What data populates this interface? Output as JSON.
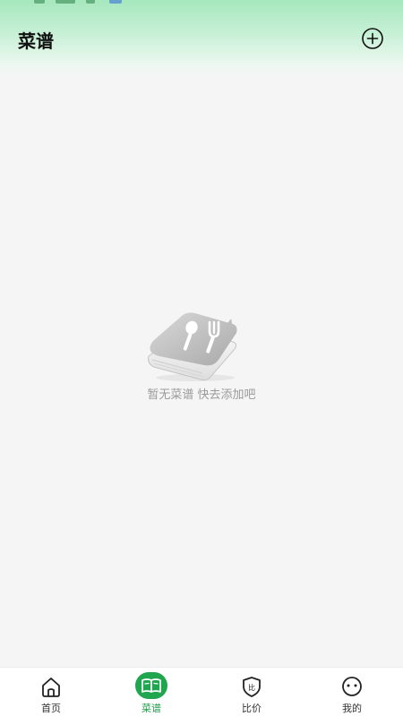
{
  "header": {
    "title": "菜谱",
    "add_icon": "plus-circle-icon"
  },
  "empty_state": {
    "illustration_icon": "recipe-book-utensils-icon",
    "message": "暂无菜谱 快去添加吧"
  },
  "tabbar": {
    "items": [
      {
        "label": "首页",
        "icon": "home-icon",
        "active": false
      },
      {
        "label": "菜谱",
        "icon": "open-book-icon",
        "active": true
      },
      {
        "label": "比价",
        "icon": "shield-compare-icon",
        "active": false
      },
      {
        "label": "我的",
        "icon": "smiley-face-icon",
        "active": false
      }
    ]
  },
  "colors": {
    "accent": "#1e9e4a",
    "header_gradient_top": "#a6e8be",
    "background": "#f5f5f5",
    "muted_text": "#9a9a9a"
  }
}
